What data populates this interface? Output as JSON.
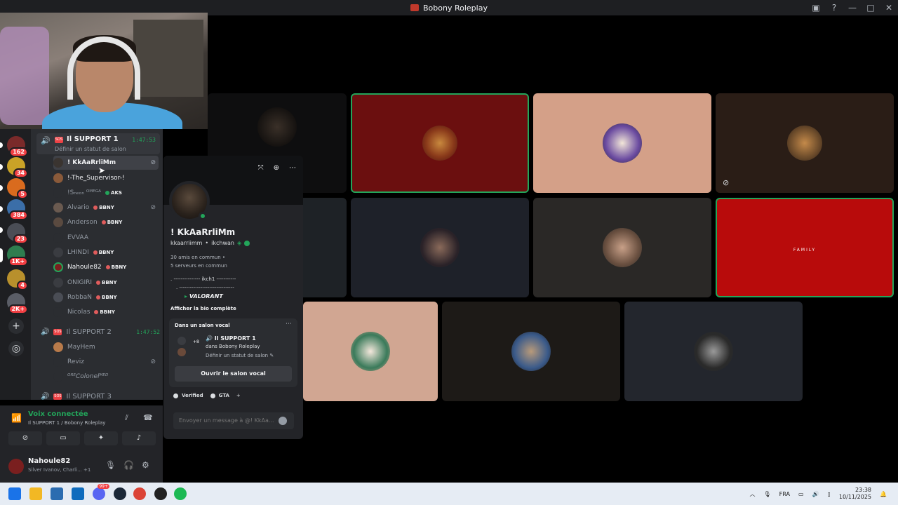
{
  "window": {
    "title": "Bobony Roleplay"
  },
  "server_badges": [
    "162",
    "34",
    "5",
    "384",
    "23",
    "1K+",
    "4",
    "2K+"
  ],
  "channel_panel": {
    "support1": {
      "name": "Il SUPPORT 1",
      "time": "1:47:53",
      "status": "Définir un statut de salon"
    },
    "members": [
      {
        "name": "! KkAaRrliMm"
      },
      {
        "name": "!-The_Supervisor-!"
      },
      {
        "name": "!Sₙₑₒₙ ᴼᴹᴱᴳᴬ",
        "badge": "AKS"
      },
      {
        "name": "Alvario",
        "badge": "BBNY"
      },
      {
        "name": "Anderson",
        "badge": "BBNY"
      },
      {
        "name": "EVVAA"
      },
      {
        "name": "LHINDI",
        "badge": "BBNY"
      },
      {
        "name": "Nahoule82",
        "badge": "BBNY"
      },
      {
        "name": "ONIGIRI",
        "badge": "BBNY"
      },
      {
        "name": "RobbaN",
        "badge": "BBNY"
      },
      {
        "name": "Nicolas",
        "badge": "BBNY"
      }
    ],
    "support2": {
      "name": "Il SUPPORT 2",
      "time": "1:47:52"
    },
    "support2_members": [
      {
        "name": "MayHem"
      },
      {
        "name": "Reviz"
      },
      {
        "name": "ᴼᴿᴱColonelᴹᴱᴰ"
      }
    ],
    "support3": {
      "name": "Il SUPPORT 3"
    }
  },
  "voice_status": {
    "title": "Voix connectée",
    "subtitle": "Il SUPPORT 1 / Bobony Roleplay"
  },
  "user": {
    "name": "Nahoule82",
    "status": "Silver Ivanov, Charli...",
    "extra": "+1"
  },
  "profile_popout": {
    "display_name": "! KkAaRrliMm",
    "username": "kkaarriimm",
    "pronoun_tag": "ikchwan",
    "mutual_friends": "30 amis en commun",
    "mutual_servers": "5 serveurs en commun",
    "bio_line1": ". --------------- ikch1 -----------",
    "bio_line2": ". -------------------------------",
    "bio_line3": "VALORANT",
    "bio_link": "Afficher la bio complète",
    "voice": {
      "title": "Dans un salon vocal",
      "plus": "+8",
      "channel": "Il SUPPORT 1",
      "server": "dans Bobony Roleplay",
      "status": "Définir un statut de salon",
      "open_button": "Ouvrir le salon vocal"
    },
    "roles": [
      "Verified",
      "GTA"
    ],
    "message_placeholder": "Envoyer un message à @! KkAa..."
  },
  "stage_tiles": [
    {
      "id": "t1",
      "bg": "#0e0e0f"
    },
    {
      "id": "t2",
      "bg": "#6b0f0f"
    },
    {
      "id": "t3",
      "bg": "#d4a088"
    },
    {
      "id": "t4",
      "bg": "#2a1d16"
    },
    {
      "id": "t5",
      "bg": "#1e2226"
    },
    {
      "id": "t6",
      "bg": "#1e2129"
    },
    {
      "id": "t7",
      "bg": "#2a2826"
    },
    {
      "id": "t8",
      "bg": "#b80b0b"
    },
    {
      "id": "t9",
      "bg": "#d1a692"
    },
    {
      "id": "t10",
      "bg": "#1d1a17"
    },
    {
      "id": "t11",
      "bg": "#23262d"
    }
  ],
  "taskbar": {
    "lang": "FRA",
    "time": "23:38",
    "date": "10/11/2025",
    "discord_badge": "99+"
  },
  "colors": {
    "green": "#23a55a",
    "red": "#ed4245",
    "panel": "#2b2d31"
  }
}
